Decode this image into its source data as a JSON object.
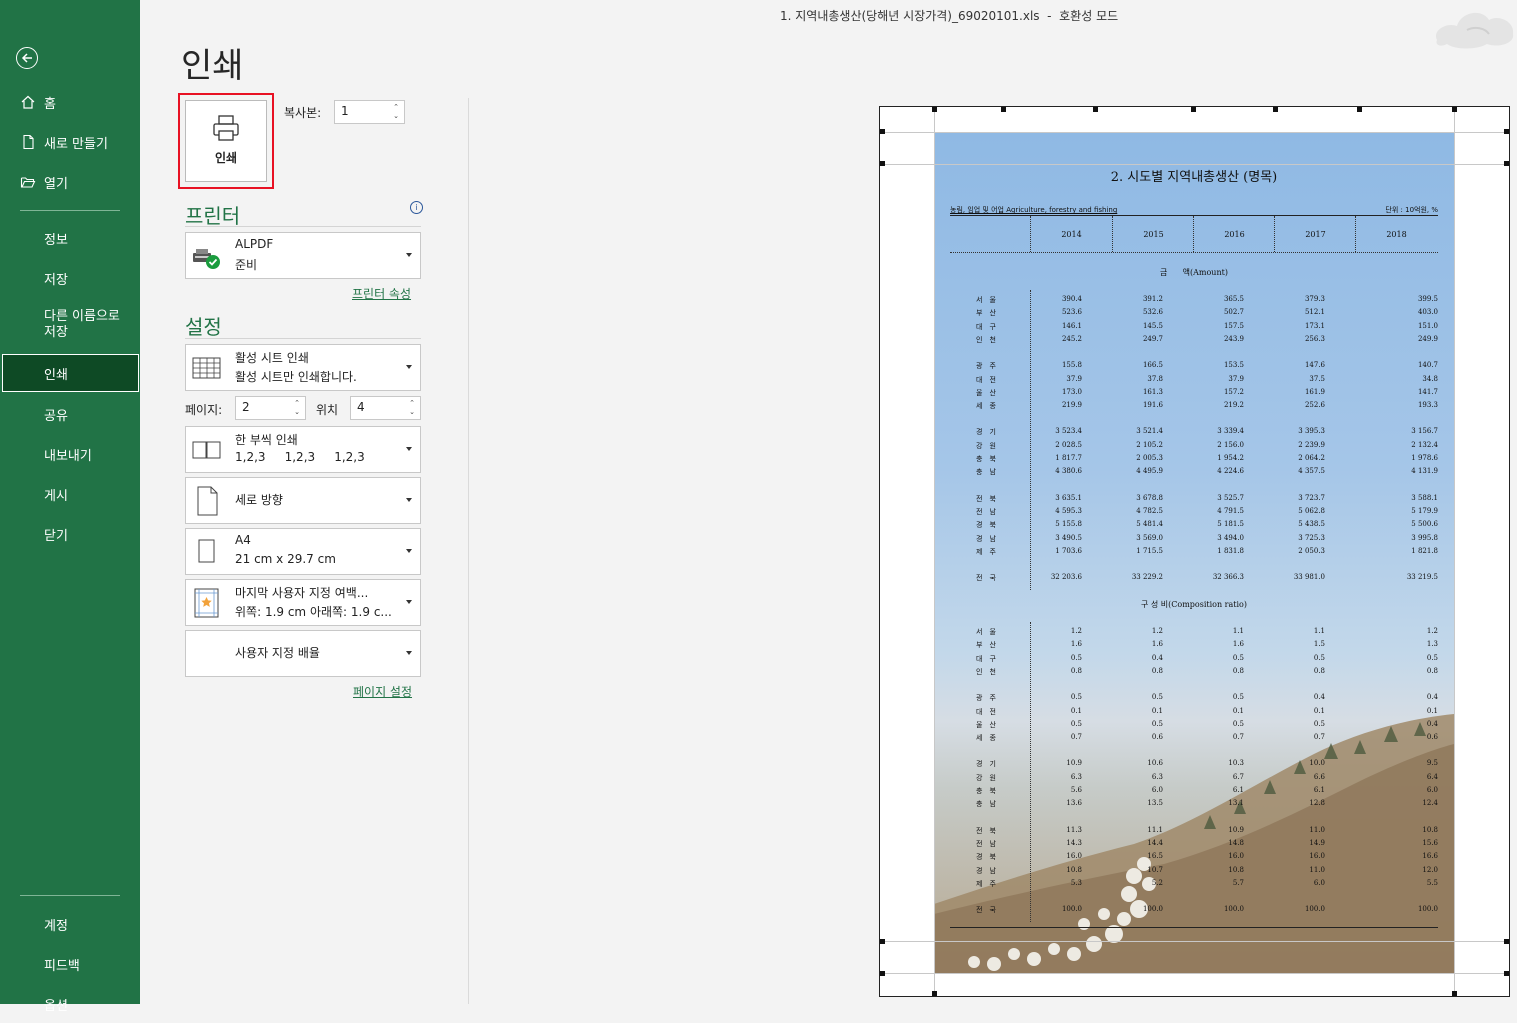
{
  "window": {
    "title": "1. 지역내총생산(당해년 시장가격)_69020101.xls  -  호환성 모드"
  },
  "nav": {
    "home": "홈",
    "new": "새로 만들기",
    "open": "열기",
    "info": "정보",
    "save": "저장",
    "save_as_1": "다른 이름으로",
    "save_as_2": "저장",
    "print": "인쇄",
    "share": "공유",
    "export": "내보내기",
    "publish": "게시",
    "close": "닫기",
    "account": "계정",
    "feedback": "피드백",
    "options": "옵션"
  },
  "print": {
    "title": "인쇄",
    "button_label": "인쇄",
    "copies_label": "복사본:",
    "copies_value": "1"
  },
  "printer": {
    "section_title": "프린터",
    "name": "ALPDF",
    "status": "준비",
    "properties_link": "프린터 속성"
  },
  "settings": {
    "section_title": "설정",
    "scope": {
      "title": "활성 시트 인쇄",
      "desc": "활성 시트만 인쇄합니다."
    },
    "pages_label": "페이지:",
    "pages_from": "2",
    "pages_to_label": "위치",
    "pages_to": "4",
    "collate": {
      "title": "한 부씩 인쇄",
      "desc": "1,2,3     1,2,3     1,2,3"
    },
    "orientation": {
      "title": "세로 방향"
    },
    "paper": {
      "title": "A4",
      "desc": "21 cm x 29.7 cm"
    },
    "margins": {
      "title": "마지막 사용자 지정 여백...",
      "desc": "위쪽: 1.9 cm 아래쪽: 1.9 c..."
    },
    "scaling": {
      "title": "사용자 지정 배율"
    },
    "page_setup_link": "페이지 설정"
  },
  "preview": {
    "sheet_title": "2. 시도별 지역내총생산 (명목)",
    "subtitle": "농림, 임업 및 어업  Agriculture, forestry and fishing",
    "unit": "단위 : 10억원, %",
    "years": [
      "2014",
      "2015",
      "2016",
      "2017",
      "2018"
    ],
    "amount_header": "금      액(Amount)",
    "ratio_header": "구   성   비(Composition ratio)",
    "amount_rows": [
      {
        "region": "서울",
        "values": [
          "390.4",
          "391.2",
          "365.5",
          "379.3",
          "399.5"
        ]
      },
      {
        "region": "부산",
        "values": [
          "523.6",
          "532.6",
          "502.7",
          "512.1",
          "403.0"
        ]
      },
      {
        "region": "대구",
        "values": [
          "146.1",
          "145.5",
          "157.5",
          "173.1",
          "151.0"
        ]
      },
      {
        "region": "인천",
        "values": [
          "245.2",
          "249.7",
          "243.9",
          "256.3",
          "249.9"
        ]
      },
      {
        "region": "광주",
        "values": [
          "155.8",
          "166.5",
          "153.5",
          "147.6",
          "140.7"
        ]
      },
      {
        "region": "대전",
        "values": [
          "37.9",
          "37.8",
          "37.9",
          "37.5",
          "34.8"
        ]
      },
      {
        "region": "울산",
        "values": [
          "173.0",
          "161.3",
          "157.2",
          "161.9",
          "141.7"
        ]
      },
      {
        "region": "세종",
        "values": [
          "219.9",
          "191.6",
          "219.2",
          "252.6",
          "193.3"
        ]
      },
      {
        "region": "경기",
        "values": [
          "3 523.4",
          "3 521.4",
          "3 339.4",
          "3 395.3",
          "3 156.7"
        ]
      },
      {
        "region": "강원",
        "values": [
          "2 028.5",
          "2 105.2",
          "2 156.0",
          "2 239.9",
          "2 132.4"
        ]
      },
      {
        "region": "충북",
        "values": [
          "1 817.7",
          "2 005.3",
          "1 954.2",
          "2 064.2",
          "1 978.6"
        ]
      },
      {
        "region": "충남",
        "values": [
          "4 380.6",
          "4 495.9",
          "4 224.6",
          "4 357.5",
          "4 131.9"
        ]
      },
      {
        "region": "전북",
        "values": [
          "3 635.1",
          "3 678.8",
          "3 525.7",
          "3 723.7",
          "3 588.1"
        ]
      },
      {
        "region": "전남",
        "values": [
          "4 595.3",
          "4 782.5",
          "4 791.5",
          "5 062.8",
          "5 179.9"
        ]
      },
      {
        "region": "경북",
        "values": [
          "5 155.8",
          "5 481.4",
          "5 181.5",
          "5 438.5",
          "5 500.6"
        ]
      },
      {
        "region": "경남",
        "values": [
          "3 490.5",
          "3 569.0",
          "3 494.0",
          "3 725.3",
          "3 995.8"
        ]
      },
      {
        "region": "제주",
        "values": [
          "1 703.6",
          "1 715.5",
          "1 831.8",
          "2 050.3",
          "1 821.8"
        ]
      },
      {
        "region": "전국",
        "values": [
          "32 203.6",
          "33 229.2",
          "32 366.3",
          "33 981.0",
          "33 219.5"
        ]
      }
    ],
    "ratio_rows": [
      {
        "region": "서울",
        "values": [
          "1.2",
          "1.2",
          "1.1",
          "1.1",
          "1.2"
        ]
      },
      {
        "region": "부산",
        "values": [
          "1.6",
          "1.6",
          "1.6",
          "1.5",
          "1.3"
        ]
      },
      {
        "region": "대구",
        "values": [
          "0.5",
          "0.4",
          "0.5",
          "0.5",
          "0.5"
        ]
      },
      {
        "region": "인천",
        "values": [
          "0.8",
          "0.8",
          "0.8",
          "0.8",
          "0.8"
        ]
      },
      {
        "region": "광주",
        "values": [
          "0.5",
          "0.5",
          "0.5",
          "0.4",
          "0.4"
        ]
      },
      {
        "region": "대전",
        "values": [
          "0.1",
          "0.1",
          "0.1",
          "0.1",
          "0.1"
        ]
      },
      {
        "region": "울산",
        "values": [
          "0.5",
          "0.5",
          "0.5",
          "0.5",
          "0.4"
        ]
      },
      {
        "region": "세종",
        "values": [
          "0.7",
          "0.6",
          "0.7",
          "0.7",
          "0.6"
        ]
      },
      {
        "region": "경기",
        "values": [
          "10.9",
          "10.6",
          "10.3",
          "10.0",
          "9.5"
        ]
      },
      {
        "region": "강원",
        "values": [
          "6.3",
          "6.3",
          "6.7",
          "6.6",
          "6.4"
        ]
      },
      {
        "region": "충북",
        "values": [
          "5.6",
          "6.0",
          "6.1",
          "6.1",
          "6.0"
        ]
      },
      {
        "region": "충남",
        "values": [
          "13.6",
          "13.5",
          "13.1",
          "12.8",
          "12.4"
        ]
      },
      {
        "region": "전북",
        "values": [
          "11.3",
          "11.1",
          "10.9",
          "11.0",
          "10.8"
        ]
      },
      {
        "region": "전남",
        "values": [
          "14.3",
          "14.4",
          "14.8",
          "14.9",
          "15.6"
        ]
      },
      {
        "region": "경북",
        "values": [
          "16.0",
          "16.5",
          "16.0",
          "16.0",
          "16.6"
        ]
      },
      {
        "region": "경남",
        "values": [
          "10.8",
          "10.7",
          "10.8",
          "11.0",
          "12.0"
        ]
      },
      {
        "region": "제주",
        "values": [
          "5.3",
          "5.2",
          "5.7",
          "6.0",
          "5.5"
        ]
      },
      {
        "region": "전국",
        "values": [
          "100.0",
          "100.0",
          "100.0",
          "100.0",
          "100.0"
        ]
      }
    ]
  },
  "colors": {
    "excel_green": "#217346",
    "selected_nav": "#0e4a25",
    "highlight_border": "#e81123"
  }
}
